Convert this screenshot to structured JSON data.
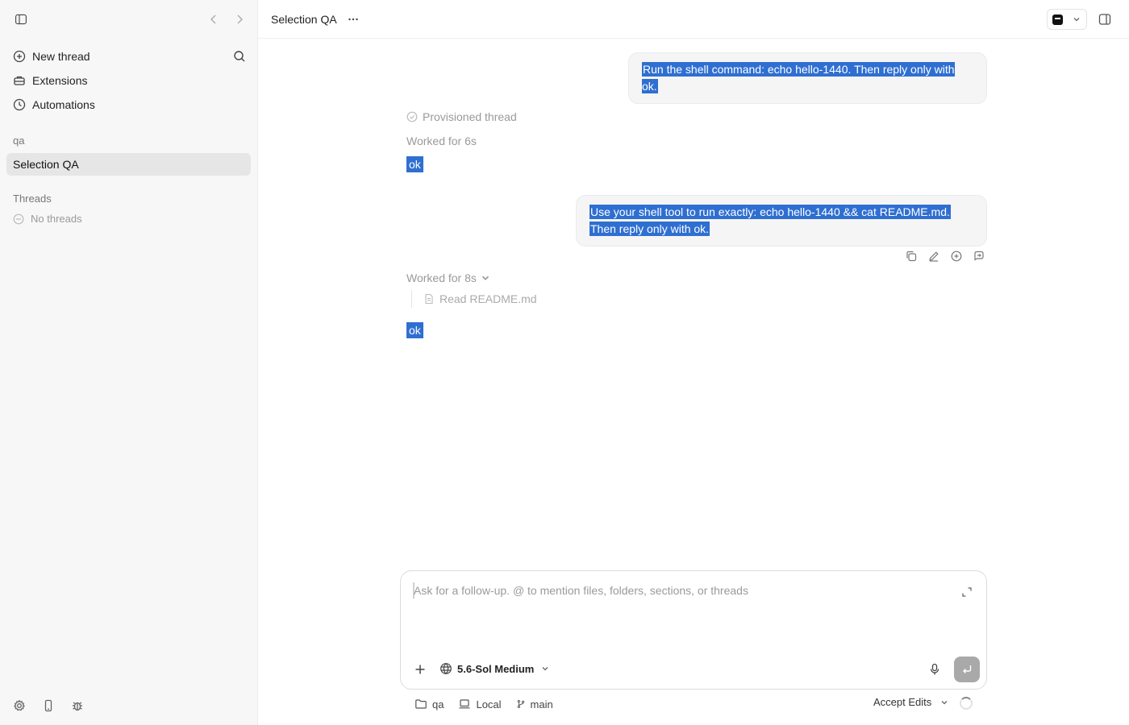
{
  "sidebar": {
    "nav": [
      {
        "label": "New thread",
        "icon": "plus-circle-icon"
      },
      {
        "label": "Extensions",
        "icon": "toolbox-icon"
      },
      {
        "label": "Automations",
        "icon": "clock-icon"
      }
    ],
    "project_section": "qa",
    "active_project_item": "Selection QA",
    "threads_section": "Threads",
    "threads_empty": "No threads"
  },
  "header": {
    "title": "Selection QA"
  },
  "conversation": {
    "messages": [
      {
        "role": "user",
        "text": "Run the shell command: echo hello-1440. Then reply only with ok."
      },
      {
        "role": "assistant",
        "status": "Provisioned thread",
        "worked": "Worked for 6s",
        "reply": "ok"
      },
      {
        "role": "user",
        "lines": [
          "Use your shell tool to run exactly: echo hello-1440 && cat README.md.",
          "Then reply only with ok."
        ]
      },
      {
        "role": "assistant",
        "worked": "Worked for 8s",
        "tool": "Read README.md",
        "reply": "ok"
      }
    ]
  },
  "composer": {
    "placeholder": "Ask for a follow-up. @ to mention files, folders, sections, or threads",
    "value": "",
    "model": "5.6-Sol Medium"
  },
  "footer": {
    "folder": "qa",
    "environment": "Local",
    "branch": "main",
    "mode": "Accept Edits"
  },
  "colors": {
    "selection": "#2f6fd1",
    "sidebar_bg": "#f7f7f7",
    "active_item_bg": "#e6e6e6",
    "send_button": "#a9a9a9"
  }
}
